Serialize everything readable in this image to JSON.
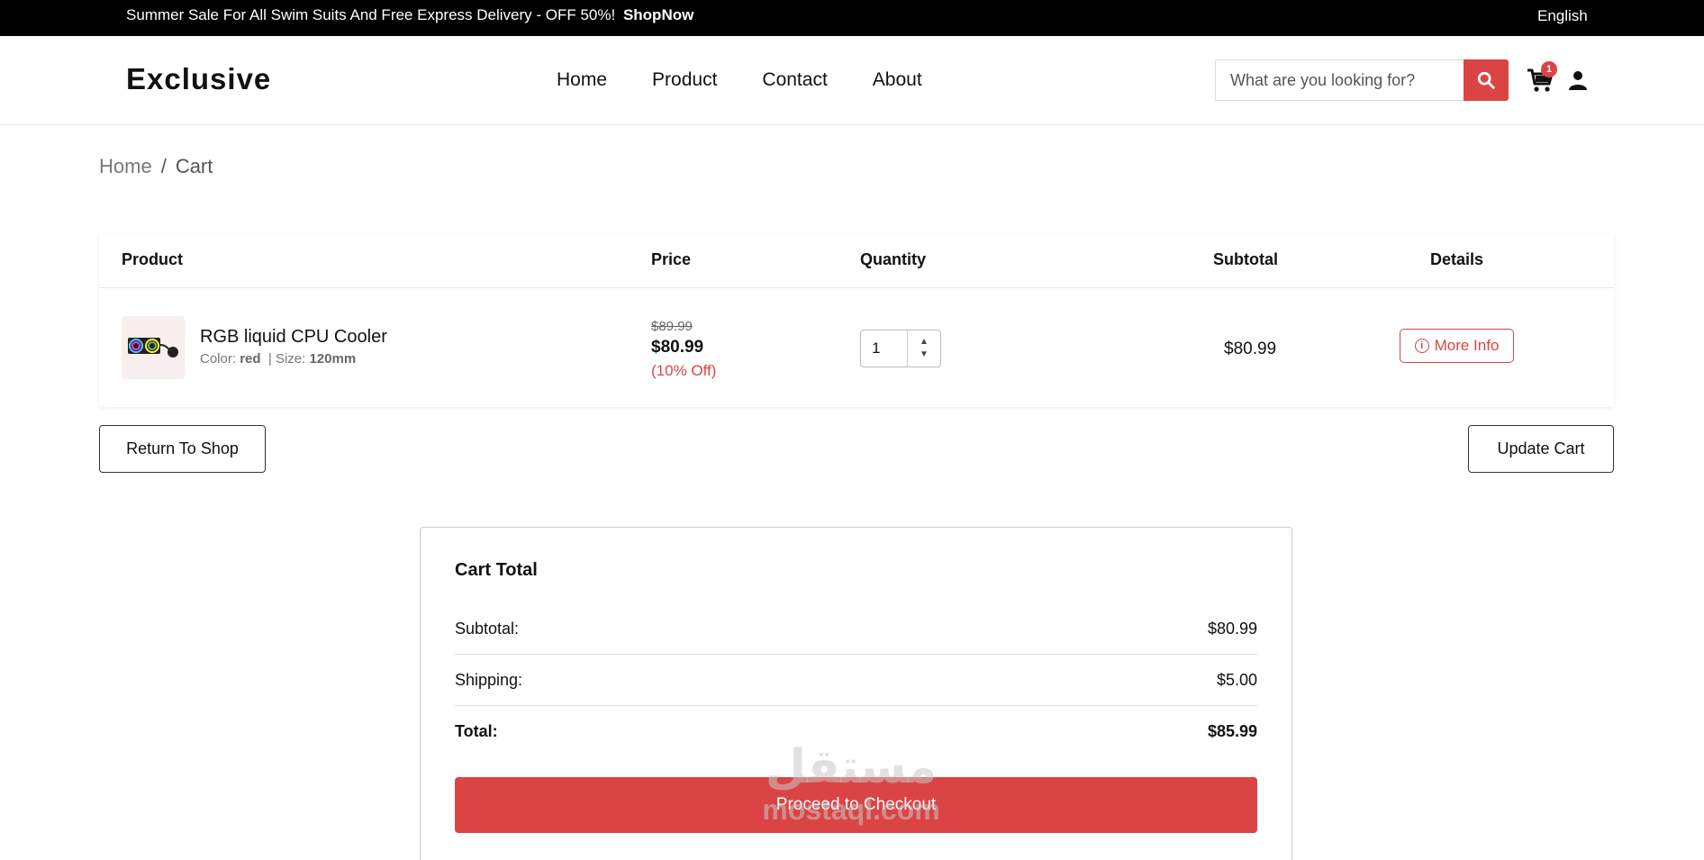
{
  "topbar": {
    "promo": "Summer Sale For All Swim Suits And Free Express Delivery - OFF 50%!",
    "promo_link": "ShopNow",
    "language": "English"
  },
  "header": {
    "logo": "Exclusive",
    "nav": [
      "Home",
      "Product",
      "Contact",
      "About"
    ],
    "search_placeholder": "What are you looking for?",
    "cart_count": "1"
  },
  "breadcrumb": {
    "home": "Home",
    "sep": "/",
    "current": "Cart"
  },
  "table": {
    "headers": [
      "Product",
      "Price",
      "Quantity",
      "Subtotal",
      "Details"
    ],
    "rows": [
      {
        "name": "RGB liquid CPU Cooler",
        "color_label": "Color:",
        "color": "red",
        "size_label": "| Size:",
        "size": "120mm",
        "old_price": "$89.99",
        "price": "$80.99",
        "discount": "(10% Off)",
        "quantity": "1",
        "subtotal": "$80.99",
        "details_label": "More Info"
      }
    ]
  },
  "actions": {
    "return": "Return To Shop",
    "update": "Update Cart"
  },
  "totals": {
    "title": "Cart Total",
    "subtotal_label": "Subtotal:",
    "subtotal": "$80.99",
    "shipping_label": "Shipping:",
    "shipping": "$5.00",
    "total_label": "Total:",
    "total": "$85.99",
    "checkout": "Proceed to Checkout"
  },
  "watermark": {
    "arabic": "مستقل",
    "latin": "mostaql.com"
  },
  "colors": {
    "accent": "#db4444",
    "topbar": "#000000"
  }
}
